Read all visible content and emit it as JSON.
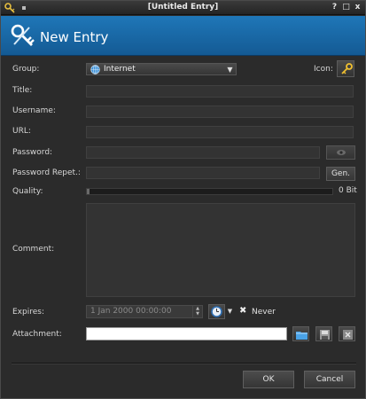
{
  "window": {
    "title": "[Untitled Entry]",
    "controls": {
      "help": "?",
      "maximize": "□",
      "close": "x"
    }
  },
  "header": {
    "title": "New Entry"
  },
  "form": {
    "group_label": "Group:",
    "group_value": "Internet",
    "icon_label": "Icon:",
    "title_label": "Title:",
    "title_value": "",
    "username_label": "Username:",
    "username_value": "",
    "url_label": "URL:",
    "url_value": "",
    "password_label": "Password:",
    "password_value": "",
    "password_repeat_label": "Password Repet.:",
    "password_repeat_value": "",
    "gen_label": "Gen.",
    "quality_label": "Quality:",
    "quality_value": "0 Bit",
    "quality_level": 0.0,
    "comment_label": "Comment:",
    "comment_value": "",
    "expires_label": "Expires:",
    "expires_value": "1 Jan 2000 00:00:00",
    "never_label": "Never",
    "never_checked": true,
    "attachment_label": "Attachment:",
    "attachment_value": ""
  },
  "buttons": {
    "ok": "OK",
    "cancel": "Cancel"
  },
  "icons": {
    "app": "key-wrench-icon",
    "header": "key-wrench-icon",
    "group": "globe-icon",
    "entry_icon": "key-icon",
    "reveal": "eye-icon",
    "expiry": "clock-icon",
    "attach_open": "folder-icon",
    "attach_save": "save-icon",
    "attach_delete": "delete-icon"
  },
  "colors": {
    "banner": "#1c6fae",
    "background": "#2b2b2b",
    "field": "#333333"
  }
}
